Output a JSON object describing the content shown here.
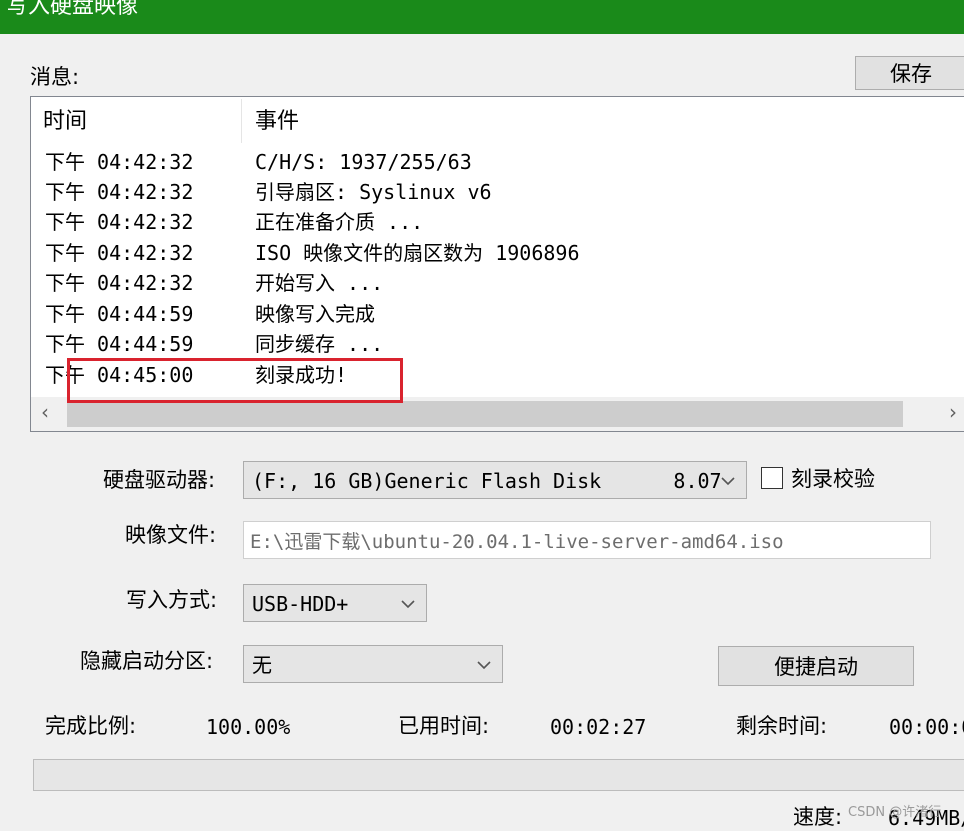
{
  "window": {
    "title": "写入硬盘映像"
  },
  "messages": {
    "label": "消息:",
    "save_label": "保存",
    "columns": {
      "time": "时间",
      "event": "事件"
    },
    "rows": [
      {
        "time": "下午 04:42:32",
        "event": "C/H/S: 1937/255/63"
      },
      {
        "time": "下午 04:42:32",
        "event": "引导扇区: Syslinux v6"
      },
      {
        "time": "下午 04:42:32",
        "event": "正在准备介质 ..."
      },
      {
        "time": "下午 04:42:32",
        "event": "ISO 映像文件的扇区数为 1906896"
      },
      {
        "time": "下午 04:42:32",
        "event": "开始写入 ..."
      },
      {
        "time": "下午 04:44:59",
        "event": "映像写入完成"
      },
      {
        "time": "下午 04:44:59",
        "event": "同步缓存 ..."
      },
      {
        "time": "下午 04:45:00",
        "event": "刻录成功!"
      }
    ],
    "highlight_color": "#d9232e"
  },
  "form": {
    "drive_label": "硬盘驱动器:",
    "drive_value": "(F:, 16 GB)Generic Flash Disk      8.07",
    "verify_label": "刻录校验",
    "verify_checked": false,
    "image_label": "映像文件:",
    "image_value": "E:\\迅雷下载\\ubuntu-20.04.1-live-server-amd64.iso",
    "mode_label": "写入方式:",
    "mode_value": "USB-HDD+",
    "hide_label": "隐藏启动分区:",
    "hide_value": "无",
    "quick_boot_label": "便捷启动"
  },
  "status": {
    "complete_label": "完成比例:",
    "complete_value": "100.00%",
    "elapsed_label": "已用时间:",
    "elapsed_value": "00:02:27",
    "remaining_label": "剩余时间:",
    "remaining_value": "00:00:0",
    "speed_label": "速度:",
    "speed_value": "6.49MB/",
    "progress_percent": 100
  },
  "watermark": "CSDN @许渚行",
  "colors": {
    "titlebar": "#1a8a1a",
    "highlight": "#d9232e"
  }
}
